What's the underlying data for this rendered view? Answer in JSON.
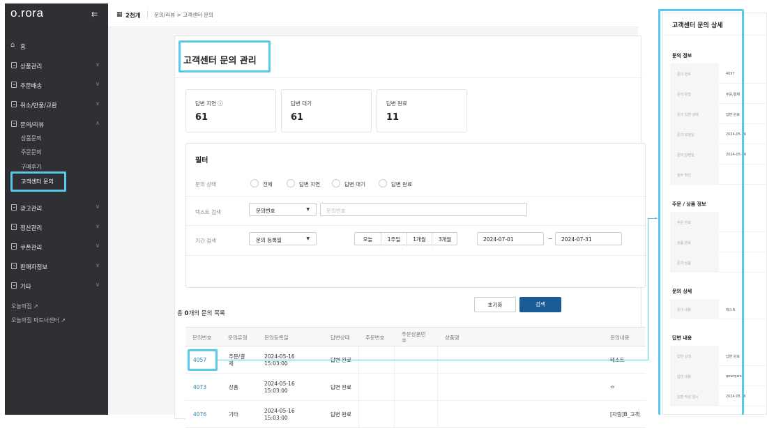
{
  "app": {
    "logo": "o.rora",
    "collapse_icon": "collapse-sidebar-icon"
  },
  "sidebar": {
    "home": "홈",
    "items": [
      {
        "label": "상품관리"
      },
      {
        "label": "주문배송"
      },
      {
        "label": "취소/반품/교환"
      },
      {
        "label": "문의/리뷰"
      },
      {
        "label": "광고관리"
      },
      {
        "label": "정산관리"
      },
      {
        "label": "쿠폰관리"
      },
      {
        "label": "판매자정보"
      },
      {
        "label": "기타"
      }
    ],
    "sub_items": [
      {
        "label": "상품문의"
      },
      {
        "label": "주문문의"
      },
      {
        "label": "구매후기"
      },
      {
        "label": "고객센터 문의"
      }
    ],
    "external": [
      {
        "label": "오늘의집"
      },
      {
        "label": "오늘의집 파트너센터"
      }
    ]
  },
  "topbar": {
    "store": "2천개",
    "breadcrumb": "문의/리뷰 > 고객센터 문의"
  },
  "page": {
    "title": "고객센터 문의 관리"
  },
  "stats": [
    {
      "label": "답변 지연",
      "value": "61"
    },
    {
      "label": "답변 대기",
      "value": "61"
    },
    {
      "label": "답변 완료",
      "value": "11"
    }
  ],
  "filter": {
    "title": "필터",
    "status_label": "문의 상태",
    "status_options": [
      "전체",
      "답변 지연",
      "답변 대기",
      "답변 완료"
    ],
    "text_label": "텍스트 검색",
    "text_select": "문의번호",
    "text_placeholder": "문의번호",
    "period_label": "기간 검색",
    "period_select": "문의 등록일",
    "period_buttons": [
      "오늘",
      "1주일",
      "1개월",
      "3개월"
    ],
    "date_from": "2024-07-01",
    "date_sep": "~",
    "date_to": "2024-07-31",
    "reset_label": "초기화",
    "search_label": "검색"
  },
  "list": {
    "count_prefix": "총 ",
    "count": "0",
    "count_suffix": "개의 문의 목록",
    "columns": [
      "문의번호",
      "문의유형",
      "문의등록일",
      "답변상태",
      "주문번호",
      "주문상품번호",
      "상품명",
      "문의내용"
    ],
    "rows": [
      {
        "id": "4057",
        "type": "주문/결제",
        "date": "2024-05-16",
        "time": "15:03:00",
        "status": "답변 완료",
        "content": "테스트"
      },
      {
        "id": "4073",
        "type": "상품",
        "date": "2024-05-16",
        "time": "15:03:00",
        "status": "답변 완료",
        "content": "ㅇ"
      },
      {
        "id": "4076",
        "type": "기타",
        "date": "2024-05-16",
        "time": "15:03:00",
        "status": "답변 완료",
        "content": "[자링]B_고객"
      }
    ]
  },
  "detail": {
    "title": "고객센터 문의 상세",
    "sections": [
      {
        "title": "문의 정보",
        "rows": [
          {
            "k": "문의 번호",
            "v": "4057"
          },
          {
            "k": "문의 유형",
            "v": "주문/결제"
          },
          {
            "k": "문의 답변 상태",
            "v": "답변 완료"
          },
          {
            "k": "문의 요청일",
            "v": "2024-05-16"
          },
          {
            "k": "문의 답변일",
            "v": "2024-05-16"
          },
          {
            "k": "첨부 확인",
            "v": ""
          }
        ]
      },
      {
        "title": "주문 / 상품 정보",
        "rows": [
          {
            "k": "주문 번호",
            "v": ""
          },
          {
            "k": "상품 번호",
            "v": ""
          },
          {
            "k": "문의 상품",
            "v": ""
          }
        ]
      },
      {
        "title": "문의 상세",
        "rows": [
          {
            "k": "문의 내용",
            "v": "테스트"
          }
        ]
      },
      {
        "title": "답변 내용",
        "rows": [
          {
            "k": "답변 상태",
            "v": "답변 완료"
          },
          {
            "k": "답변 내용",
            "v": "qewrqwer"
          },
          {
            "k": "답변 작성 일시",
            "v": "2024.05.16"
          }
        ]
      }
    ]
  },
  "colors": {
    "sidebar_bg": "#2e3033",
    "highlight": "#5ac8ea",
    "primary": "#1a5a96",
    "link": "#2a86b8"
  }
}
